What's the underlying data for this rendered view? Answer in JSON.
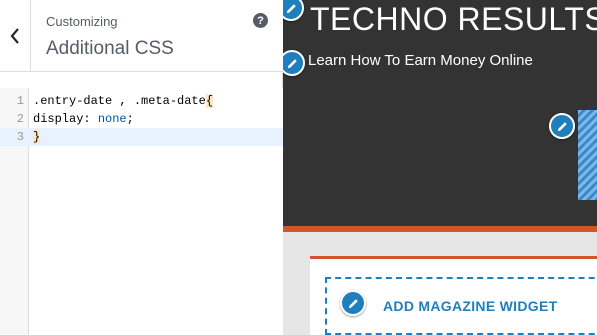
{
  "customizer": {
    "breadcrumb": "Customizing",
    "title": "Additional CSS",
    "help": "?"
  },
  "editor": {
    "lines": [
      {
        "number": "1",
        "text": ".entry-date , .meta-date{"
      },
      {
        "number": "2",
        "text": "display: none;"
      },
      {
        "number": "3",
        "text": "}"
      }
    ]
  },
  "preview": {
    "site_title": "TECHNO RESULTS",
    "tagline": "Learn How To Earn Money Online",
    "widget_button": "ADD MAGAZINE WIDGET"
  },
  "colors": {
    "accent": "#d2542f",
    "link_blue": "#1f7fbd",
    "header_bg": "#333333"
  },
  "icons": [
    "chevron-left-icon",
    "help-icon",
    "pencil-icon"
  ]
}
